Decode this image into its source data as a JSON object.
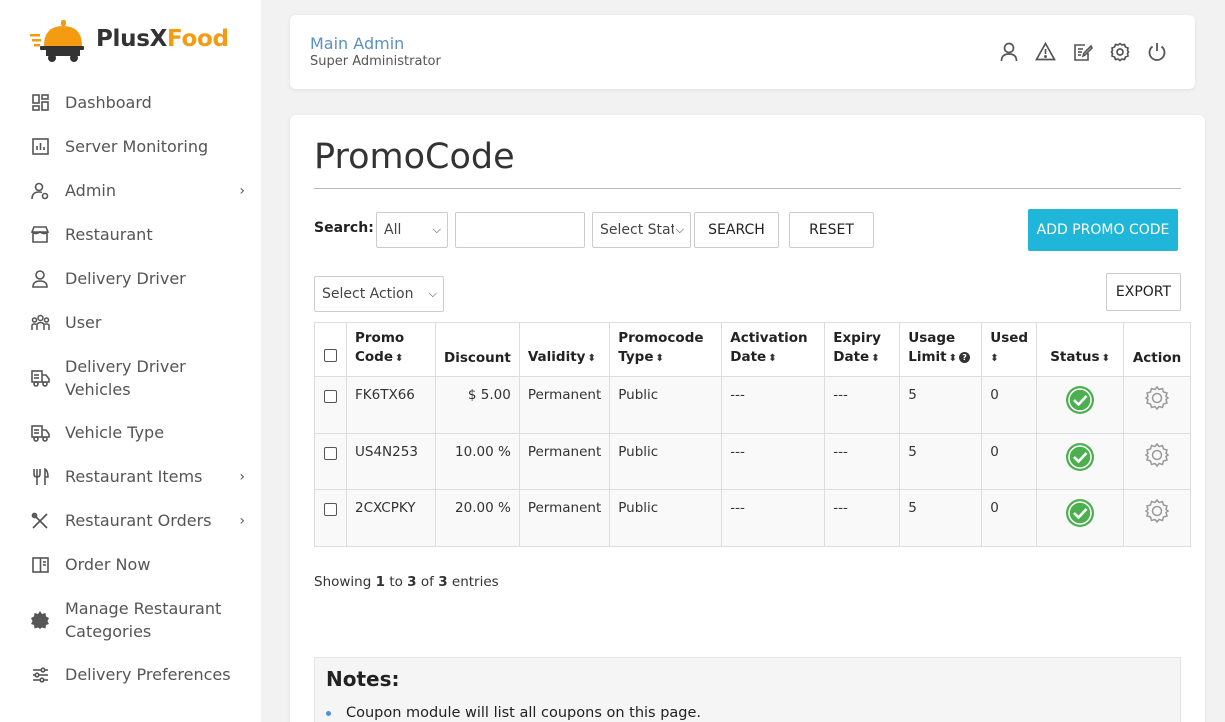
{
  "brand": {
    "part1": "PlusX",
    "part2": "Food",
    "accent": "#f39c12"
  },
  "sidebar": {
    "items": [
      {
        "label": "Dashboard",
        "icon": "dashboard-icon",
        "has_children": false
      },
      {
        "label": "Server Monitoring",
        "icon": "bar-chart-icon",
        "has_children": false
      },
      {
        "label": "Admin",
        "icon": "user-gear-icon",
        "has_children": true
      },
      {
        "label": "Restaurant",
        "icon": "store-icon",
        "has_children": false
      },
      {
        "label": "Delivery Driver",
        "icon": "driver-icon",
        "has_children": false
      },
      {
        "label": "User",
        "icon": "users-icon",
        "has_children": false
      },
      {
        "label": "Delivery Driver Vehicles",
        "icon": "truck-icon",
        "has_children": false
      },
      {
        "label": "Vehicle Type",
        "icon": "truck-icon",
        "has_children": false
      },
      {
        "label": "Restaurant Items",
        "icon": "fork-knife-icon",
        "has_children": true
      },
      {
        "label": "Restaurant Orders",
        "icon": "utensils-cross-icon",
        "has_children": true
      },
      {
        "label": "Order Now",
        "icon": "menu-book-icon",
        "has_children": false
      },
      {
        "label": "Manage Restaurant Categories",
        "icon": "badge-icon",
        "has_children": false
      },
      {
        "label": "Delivery Preferences",
        "icon": "sliders-icon",
        "has_children": false
      }
    ],
    "chevron": "›"
  },
  "header": {
    "name": "Main Admin",
    "role": "Super Administrator",
    "icons": [
      "profile-icon",
      "alert-icon",
      "edit-icon",
      "settings-icon",
      "power-icon"
    ]
  },
  "page": {
    "title": "PromoCode",
    "search_label": "Search:",
    "filter_select": "All",
    "search_placeholder": "",
    "status_select": "Select Stat",
    "search_button": "SEARCH",
    "reset_button": "RESET",
    "add_button": "ADD PROMO CODE",
    "action_select": "Select Action",
    "export_button": "EXPORT"
  },
  "table": {
    "headers": {
      "promo_code_1": "Promo",
      "promo_code_2": "Code",
      "discount": "Discount",
      "validity": "Validity",
      "type_1": "Promocode",
      "type_2": "Type",
      "activation_1": "Activation",
      "activation_2": "Date",
      "expiry_1": "Expiry",
      "expiry_2": "Date",
      "usage_1": "Usage",
      "usage_2": "Limit",
      "used": "Used",
      "status": "Status",
      "action": "Action"
    },
    "rows": [
      {
        "code": "FK6TX66",
        "discount": "$ 5.00",
        "validity": "Permanent",
        "type": "Public",
        "activation": "---",
        "expiry": "---",
        "limit": "5",
        "used": "0"
      },
      {
        "code": "US4N253",
        "discount": "10.00 %",
        "validity": "Permanent",
        "type": "Public",
        "activation": "---",
        "expiry": "---",
        "limit": "5",
        "used": "0"
      },
      {
        "code": "2CXCPKY",
        "discount": "20.00 %",
        "validity": "Permanent",
        "type": "Public",
        "activation": "---",
        "expiry": "---",
        "limit": "5",
        "used": "0"
      }
    ]
  },
  "showing": {
    "prefix": "Showing",
    "from": "1",
    "to_word": "to",
    "to": "3",
    "of_word": "of",
    "total": "3",
    "suffix": "entries"
  },
  "notes": {
    "title": "Notes:",
    "items": [
      "Coupon module will list all coupons on this page."
    ]
  }
}
